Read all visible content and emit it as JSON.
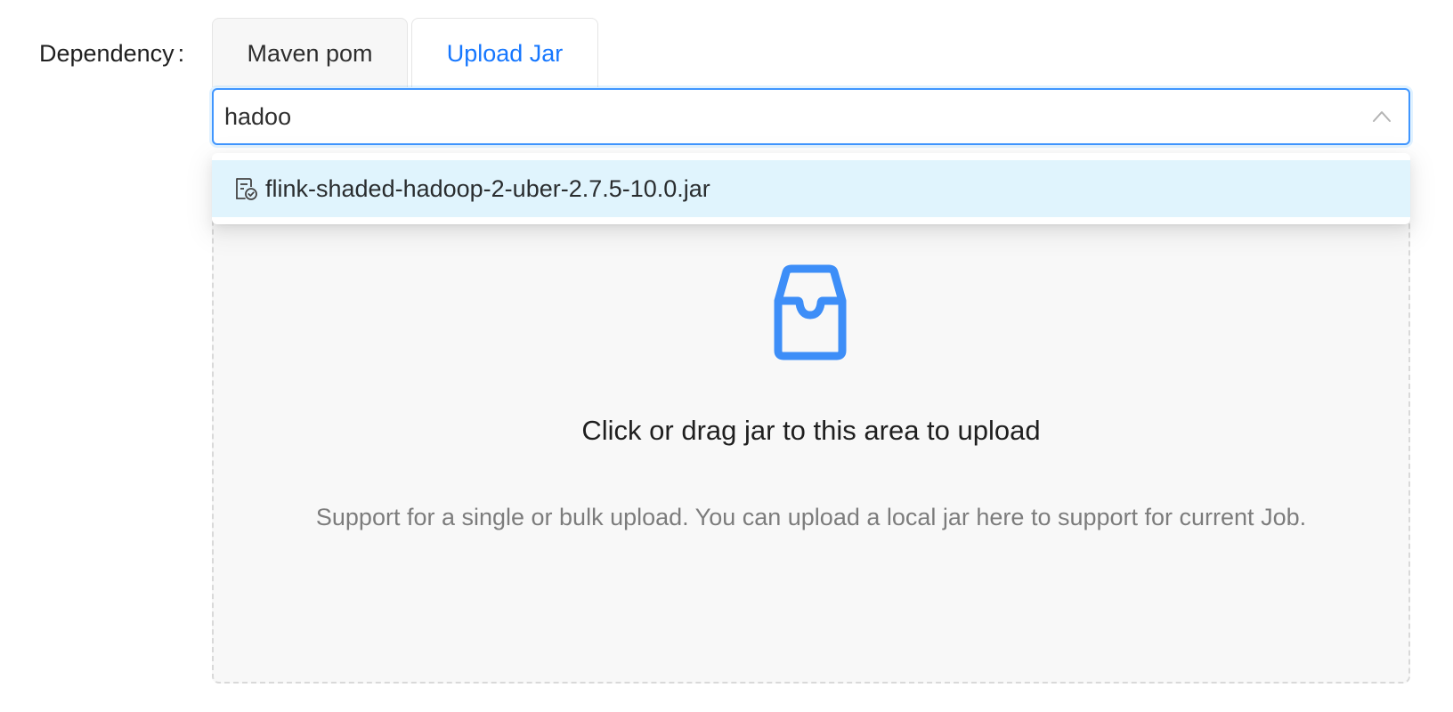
{
  "form": {
    "label": "Dependency",
    "colon": ":"
  },
  "tabs": [
    {
      "label": "Maven pom",
      "active": false
    },
    {
      "label": "Upload Jar",
      "active": true
    }
  ],
  "search": {
    "value": "hadoo",
    "placeholder": ""
  },
  "dropdown": {
    "options": [
      {
        "label": "flink-shaded-hadoop-2-uber-2.7.5-10.0.jar",
        "icon": "file-check-icon"
      }
    ]
  },
  "uploader": {
    "icon": "inbox-icon",
    "text": "Click or drag jar to this area to upload",
    "hint": "Support for a single or bulk upload. You can upload a local jar here to support for current Job."
  },
  "colors": {
    "accent": "#1677ff",
    "option_highlight": "#e0f4fd",
    "icon_blue": "#3d8ef8"
  }
}
